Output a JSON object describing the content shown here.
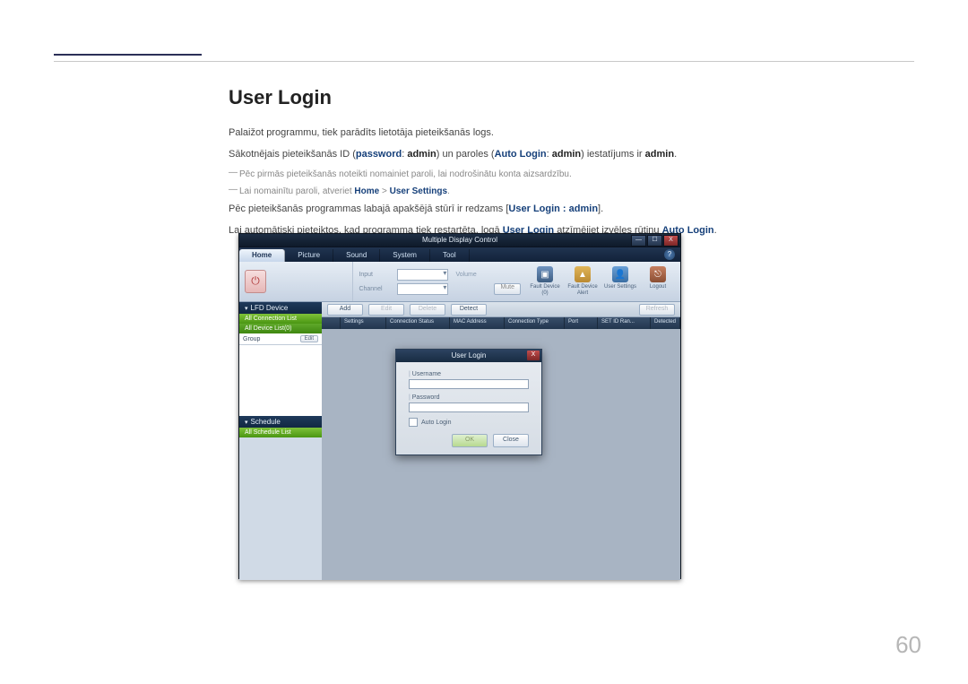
{
  "page_number": "60",
  "heading": "User Login",
  "p1": "Palaižot programmu, tiek parādīts lietotāja pieteikšanās logs.",
  "p2_pre": "Sākotnējais pieteikšanās ID (",
  "p2_pw": "password",
  "p2_mid1": ": ",
  "p2_admin1": "admin",
  "p2_mid2": ") un paroles (",
  "p2_auto": "Auto Login",
  "p2_mid3": ": ",
  "p2_admin2": "admin",
  "p2_mid4": ") iestatījums ir ",
  "p2_admin3": "admin",
  "p2_post": ".",
  "note1": "Pēc pirmās pieteikšanās noteikti nomainiet paroli, lai nodrošinātu konta aizsardzību.",
  "note2_pre": "Lai nomainītu paroli, atveriet ",
  "note2_home": "Home",
  "note2_gt": " > ",
  "note2_us": "User Settings",
  "note2_post": ".",
  "p3_pre": "Pēc pieteikšanās programmas labajā apakšējā stūrī ir redzams [",
  "p3_ul": "User Login : admin",
  "p3_post": "].",
  "p4_pre": "Lai automātiski pieteiktos, kad programma tiek restartēta, logā ",
  "p4_ul": "User Login",
  "p4_mid": " atzīmējiet izvēles rūtiņu ",
  "p4_auto": "Auto Login",
  "p4_post": ".",
  "app": {
    "title": "Multiple Display Control",
    "tabs": {
      "home": "Home",
      "picture": "Picture",
      "sound": "Sound",
      "system": "System",
      "tool": "Tool"
    },
    "help": "?",
    "win": {
      "min": "—",
      "max": "☐",
      "close": "X"
    },
    "toolbar": {
      "power_icon": "⏻",
      "row1_a": "Input",
      "row1_b": "Volume",
      "row2_a": "Channel",
      "mute": "Mute",
      "icons": {
        "fault1": "Fault Device (0)",
        "fault2": "Fault Device Alert",
        "user": "User Settings",
        "logout": "Logout"
      },
      "glyph_fault": "▣",
      "glyph_alert": "▲",
      "glyph_user": "👤",
      "glyph_logout": "⎋"
    },
    "sidebar": {
      "hdr1": "LFD Device",
      "sub1": "All Connection List",
      "sub2": "All Device List(0)",
      "group": "Group",
      "edit": "Edit",
      "hdr2": "Schedule",
      "sub3": "All Schedule List"
    },
    "main_btns": {
      "add": "Add",
      "edit": "Edit",
      "delete": "Delete",
      "detect": "Detect",
      "refresh": "Refresh"
    },
    "columns": [
      "",
      "Settings",
      "Connection Status",
      "MAC Address",
      "Connection Type",
      "Port",
      "SET ID Ran...",
      "Detected"
    ],
    "dialog": {
      "title": "User Login",
      "username": "Username",
      "password": "Password",
      "auto": "Auto Login",
      "ok": "OK",
      "close": "Close",
      "x": "X"
    }
  }
}
